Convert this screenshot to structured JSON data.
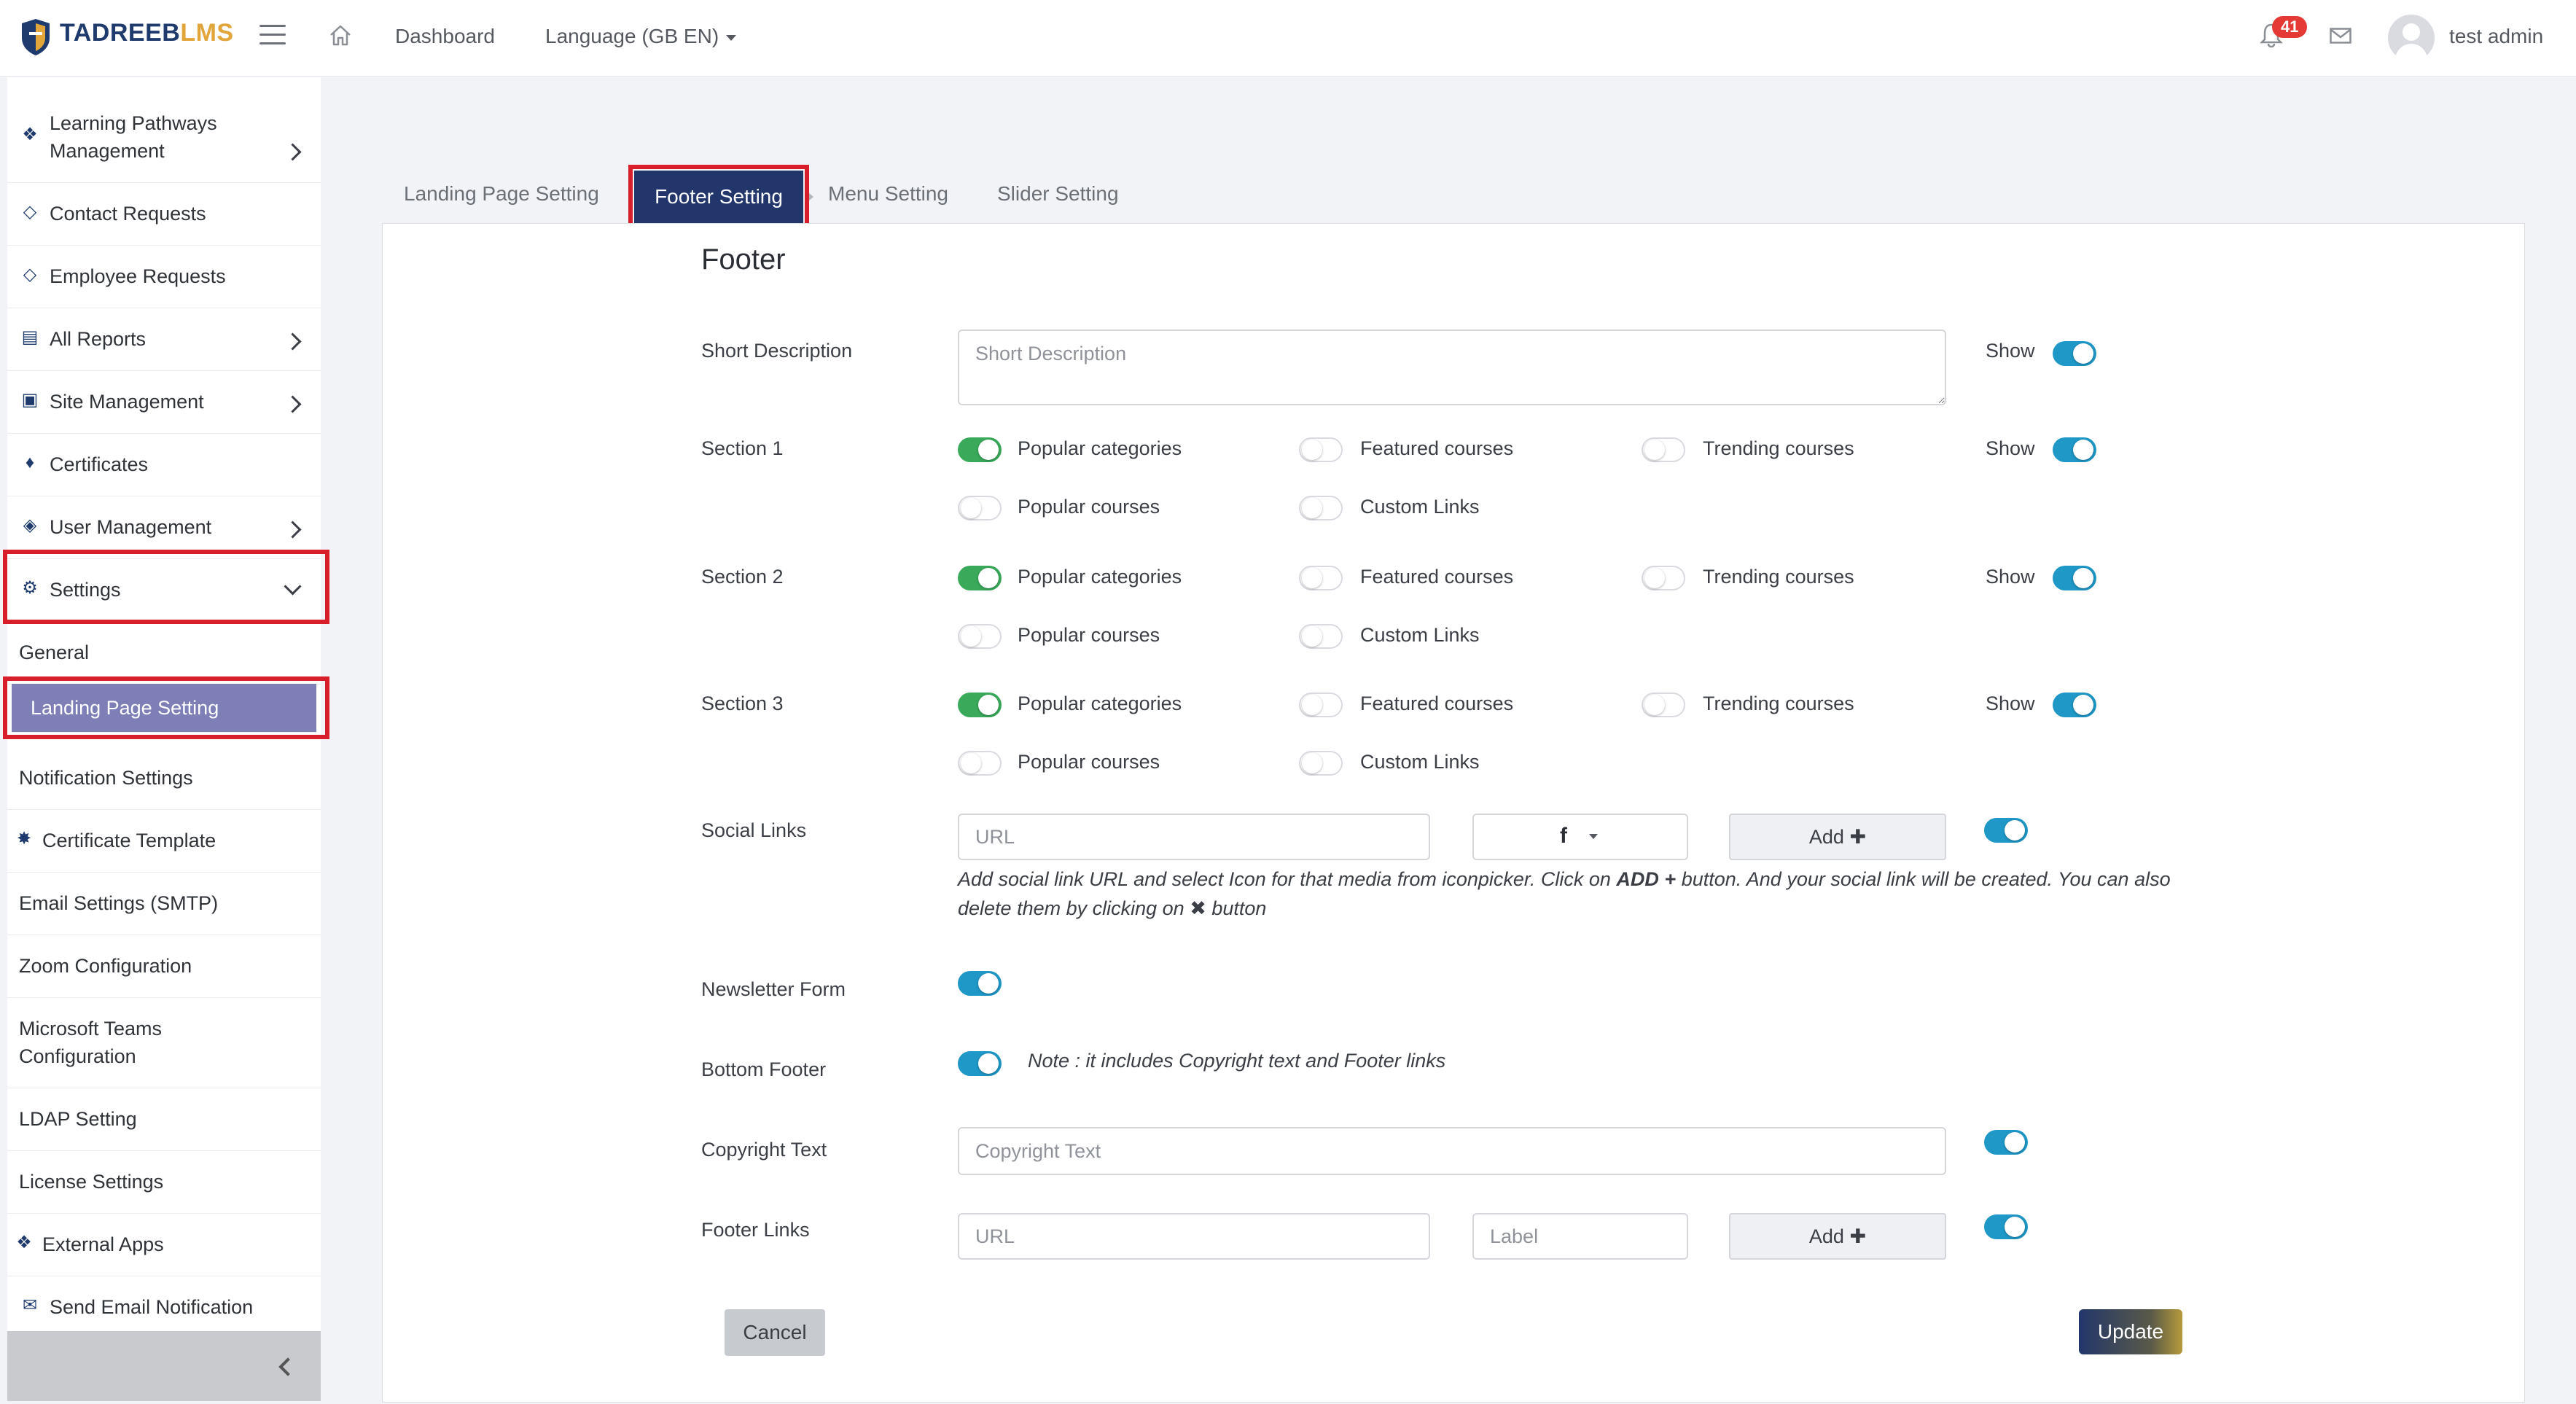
{
  "brand": {
    "name_part1": "TADREEB",
    "name_part2": "LMS"
  },
  "topbar": {
    "dashboard": "Dashboard",
    "language": "Language (GB EN)",
    "notifications_count": "41",
    "username": "test admin"
  },
  "sidebar": {
    "items": [
      {
        "label": "Learning Pathways Management",
        "icon": "puzzle-icon"
      },
      {
        "label": "Contact Requests",
        "icon": "tag-icon"
      },
      {
        "label": "Employee Requests",
        "icon": "tag-icon"
      },
      {
        "label": "All Reports",
        "icon": "chart-icon"
      },
      {
        "label": "Site Management",
        "icon": "folder-icon"
      },
      {
        "label": "Certificates",
        "icon": "trophy-icon"
      },
      {
        "label": "User Management",
        "icon": "shield-icon"
      },
      {
        "label": "Settings",
        "icon": "gear-icon"
      },
      {
        "label": "General"
      },
      {
        "label": "Landing Page Setting"
      },
      {
        "label": "Notification Settings"
      },
      {
        "label": "Certificate Template",
        "icon": "badge-icon"
      },
      {
        "label": "Email Settings (SMTP)"
      },
      {
        "label": "Zoom Configuration"
      },
      {
        "label": "Microsoft Teams Configuration"
      },
      {
        "label": "LDAP Setting"
      },
      {
        "label": "License Settings"
      },
      {
        "label": "External Apps",
        "icon": "puzzle-icon"
      },
      {
        "label": "Send Email Notification",
        "icon": "envelope-icon"
      }
    ]
  },
  "tabs": [
    "Landing Page Setting",
    "Footer Setting",
    "Menu Setting",
    "Slider Setting"
  ],
  "form": {
    "heading": "Footer",
    "show_label": "Show",
    "short_description": {
      "label": "Short Description",
      "placeholder": "Short Description",
      "show": true
    },
    "option_labels": {
      "popular_categories": "Popular categories",
      "featured_courses": "Featured courses",
      "trending_courses": "Trending courses",
      "popular_courses": "Popular courses",
      "custom_links": "Custom Links"
    },
    "sections": [
      {
        "label": "Section 1",
        "popular_categories": true,
        "featured_courses": false,
        "trending_courses": false,
        "popular_courses": false,
        "custom_links": false,
        "show": true
      },
      {
        "label": "Section 2",
        "popular_categories": true,
        "featured_courses": false,
        "trending_courses": false,
        "popular_courses": false,
        "custom_links": false,
        "show": true
      },
      {
        "label": "Section 3",
        "popular_categories": true,
        "featured_courses": false,
        "trending_courses": false,
        "popular_courses": false,
        "custom_links": false,
        "show": true
      }
    ],
    "social_links": {
      "label": "Social Links",
      "url_placeholder": "URL",
      "icon_value": "facebook-icon",
      "add_label": "Add",
      "enabled": true,
      "help_part1": "Add social link URL and select Icon for that media from iconpicker. Click on",
      "help_add": "ADD +",
      "help_part2": "button. And your social link will be created. You can also delete them by clicking on",
      "help_part3": "button"
    },
    "newsletter": {
      "label": "Newsletter Form",
      "enabled": true
    },
    "bottom_footer": {
      "label": "Bottom Footer",
      "enabled": true,
      "note": "Note : it includes Copyright text and Footer links"
    },
    "copyright": {
      "label": "Copyright Text",
      "placeholder": "Copyright Text",
      "enabled": true
    },
    "footer_links": {
      "label": "Footer Links",
      "url_placeholder": "URL",
      "label_placeholder": "Label",
      "add_label": "Add",
      "enabled": true
    },
    "cancel_label": "Cancel",
    "update_label": "Update"
  },
  "colors": {
    "primary": "#22366b",
    "accent": "#e2a53a",
    "toggle_green": "#3aa95a",
    "toggle_blue": "#1f97c7",
    "highlight_red": "#d81e2a",
    "sidebar_active": "#7d7fb6"
  }
}
